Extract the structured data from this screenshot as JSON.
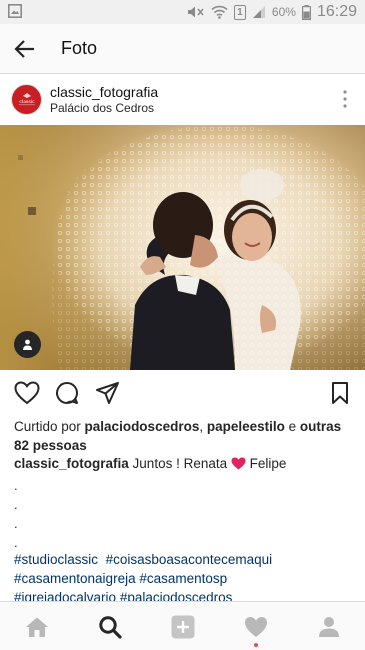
{
  "status_bar": {
    "battery": "60%",
    "time": "16:29",
    "sim": "1"
  },
  "app_bar": {
    "title": "Foto"
  },
  "post": {
    "username": "classic_fotografia",
    "location": "Palácio dos Cedros",
    "avatar_text": "classic fotografia",
    "likes": {
      "prefix": "Curtido por ",
      "user1": "palaciodoscedros",
      "sep": ", ",
      "user2": "papeleestilo",
      "conj": " e ",
      "others": "outras 82 pessoas"
    },
    "caption": {
      "user": "classic_fotografia",
      "text1": " Juntos ! Renata ",
      "text2": " Felipe"
    },
    "dots": [
      ".",
      ".",
      ".",
      "."
    ],
    "hashtags": [
      "#studioclassic",
      "#coisasboasacontecemaqui",
      "#casamentonaigreja",
      "#casamentosp",
      "#igrejadocalvario",
      "#palaciodoscedros"
    ]
  },
  "colors": {
    "hashtag": "#003569",
    "notification": "#ed4956",
    "avatar_bg": "#c81f24"
  },
  "icons": {
    "status_left": "image-icon",
    "status_right": [
      "mute-icon",
      "wifi-icon",
      "sim-icon",
      "signal-icon",
      "battery-icon"
    ],
    "actions": [
      "heart-icon",
      "comment-icon",
      "share-icon",
      "bookmark-icon"
    ],
    "nav": [
      "home-icon",
      "search-icon",
      "add-icon",
      "activity-heart-icon",
      "profile-icon"
    ]
  }
}
